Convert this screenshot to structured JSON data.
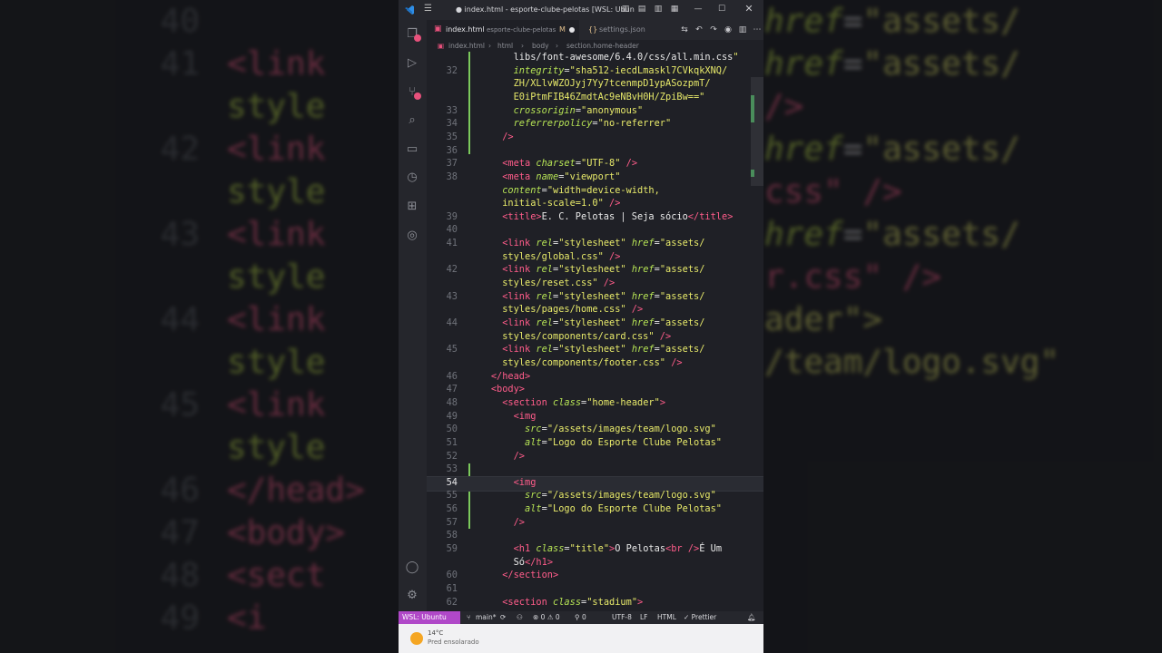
{
  "background": {
    "left_lines": [
      {
        "no": "40",
        "text": ""
      },
      {
        "no": "41",
        "text": "<link"
      },
      {
        "no": "",
        "text": "style"
      },
      {
        "no": "42",
        "text": "<link"
      },
      {
        "no": "",
        "text": "style"
      },
      {
        "no": "43",
        "text": "<link"
      },
      {
        "no": "",
        "text": "style"
      },
      {
        "no": "44",
        "text": "<link"
      },
      {
        "no": "",
        "text": "style"
      },
      {
        "no": "45",
        "text": "<link"
      },
      {
        "no": "",
        "text": "style"
      },
      {
        "no": "46",
        "text": "</head>"
      },
      {
        "no": "47",
        "text": "<body>"
      },
      {
        "no": "48",
        "text": "<sect"
      },
      {
        "no": "49",
        "text": "<i"
      }
    ],
    "right_lines": [
      "href=\"assets/",
      "",
      "href=\"assets/",
      "/>",
      "href=\"assets/",
      "css\" />",
      "href=\"assets/",
      "r.css\" />",
      "",
      "",
      "",
      "",
      "ader\">",
      "",
      "/team/logo.svg\""
    ]
  },
  "titlebar": {
    "title": "● index.html - esporte-clube-pelotas [WSL: Ubun"
  },
  "tabs": [
    {
      "label": "index.html",
      "detail": "esporte-clube-pelotas",
      "status": "M",
      "active": true
    },
    {
      "label": "settings.json",
      "active": false
    }
  ],
  "breadcrumb": [
    "index.html",
    "html",
    "body",
    "section.home-header"
  ],
  "code_lines": [
    {
      "no": "",
      "html": "        <span class='tx'>libs/font-awesome/6.4.0/css/all.min.css</span><span class='st'>\"</span>"
    },
    {
      "no": "32",
      "html": "        <span class='at'>integrity</span>=<span class='st'>\"sha512-iecdLmaskl7CVkqkXNQ/</span>"
    },
    {
      "no": "",
      "html": "        <span class='st'>ZH/XLlvWZOJyj7Yy7tcenmpD1ypASozpmT/</span>"
    },
    {
      "no": "",
      "html": "        <span class='st'>E0iPtmFIB46ZmdtAc9eNBvH0H/ZpiBw==\"</span>"
    },
    {
      "no": "33",
      "html": "        <span class='at'>crossorigin</span>=<span class='st'>\"anonymous\"</span>"
    },
    {
      "no": "34",
      "html": "        <span class='at'>referrerpolicy</span>=<span class='st'>\"no-referrer\"</span>"
    },
    {
      "no": "35",
      "html": "      <span class='tg'>/&gt;</span>"
    },
    {
      "no": "36",
      "html": ""
    },
    {
      "no": "37",
      "html": "      <span class='tg'>&lt;meta</span> <span class='at'>charset</span>=<span class='st'>\"UTF-8\"</span> <span class='tg'>/&gt;</span>"
    },
    {
      "no": "38",
      "html": "      <span class='tg'>&lt;meta</span> <span class='at'>name</span>=<span class='st'>\"viewport\"</span>"
    },
    {
      "no": "",
      "html": "      <span class='at'>content</span>=<span class='st'>\"width=device-width,</span>"
    },
    {
      "no": "",
      "html": "      <span class='st'>initial-scale=1.0\"</span> <span class='tg'>/&gt;</span>"
    },
    {
      "no": "39",
      "html": "      <span class='tg'>&lt;title&gt;</span><span class='tx'>E. C. Pelotas | Seja sócio</span><span class='tg'>&lt;/title&gt;</span>"
    },
    {
      "no": "40",
      "html": ""
    },
    {
      "no": "41",
      "html": "      <span class='tg'>&lt;link</span> <span class='at'>rel</span>=<span class='st'>\"stylesheet\"</span> <span class='at'>href</span>=<span class='st'>\"assets/</span>"
    },
    {
      "no": "",
      "html": "      <span class='st'>styles/global.css\"</span> <span class='tg'>/&gt;</span>"
    },
    {
      "no": "42",
      "html": "      <span class='tg'>&lt;link</span> <span class='at'>rel</span>=<span class='st'>\"stylesheet\"</span> <span class='at'>href</span>=<span class='st'>\"assets/</span>"
    },
    {
      "no": "",
      "html": "      <span class='st'>styles/reset.css\"</span> <span class='tg'>/&gt;</span>"
    },
    {
      "no": "43",
      "html": "      <span class='tg'>&lt;link</span> <span class='at'>rel</span>=<span class='st'>\"stylesheet\"</span> <span class='at'>href</span>=<span class='st'>\"assets/</span>"
    },
    {
      "no": "",
      "html": "      <span class='st'>styles/pages/home.css\"</span> <span class='tg'>/&gt;</span>"
    },
    {
      "no": "44",
      "html": "      <span class='tg'>&lt;link</span> <span class='at'>rel</span>=<span class='st'>\"stylesheet\"</span> <span class='at'>href</span>=<span class='st'>\"assets/</span>"
    },
    {
      "no": "",
      "html": "      <span class='st'>styles/components/card.css\"</span> <span class='tg'>/&gt;</span>"
    },
    {
      "no": "45",
      "html": "      <span class='tg'>&lt;link</span> <span class='at'>rel</span>=<span class='st'>\"stylesheet\"</span> <span class='at'>href</span>=<span class='st'>\"assets/</span>"
    },
    {
      "no": "",
      "html": "      <span class='st'>styles/components/footer.css\"</span> <span class='tg'>/&gt;</span>"
    },
    {
      "no": "46",
      "html": "    <span class='tg'>&lt;/head&gt;</span>"
    },
    {
      "no": "47",
      "html": "    <span class='tg'>&lt;body&gt;</span>"
    },
    {
      "no": "48",
      "html": "      <span class='tg'>&lt;section</span> <span class='at'>class</span>=<span class='st'>\"home-header\"</span><span class='tg'>&gt;</span>"
    },
    {
      "no": "49",
      "html": "        <span class='tg'>&lt;img</span>"
    },
    {
      "no": "50",
      "html": "          <span class='at'>src</span>=<span class='st'>\"/assets/images/team/logo.svg\"</span>"
    },
    {
      "no": "51",
      "html": "          <span class='at'>alt</span>=<span class='st'>\"Logo do Esporte Clube Pelotas\"</span>"
    },
    {
      "no": "52",
      "html": "        <span class='tg'>/&gt;</span>"
    },
    {
      "no": "53",
      "html": ""
    },
    {
      "no": "54",
      "html": "        <span class='tg'>&lt;img</span>"
    },
    {
      "no": "55",
      "html": "          <span class='at'>src</span>=<span class='st'>\"/assets/images/team/logo.svg\"</span>"
    },
    {
      "no": "56",
      "html": "          <span class='at'>alt</span>=<span class='st'>\"Logo do Esporte Clube Pelotas\"</span>"
    },
    {
      "no": "57",
      "html": "        <span class='tg'>/&gt;</span>"
    },
    {
      "no": "58",
      "html": ""
    },
    {
      "no": "59",
      "html": "        <span class='tg'>&lt;h1</span> <span class='at'>class</span>=<span class='st'>\"title\"</span><span class='tg'>&gt;</span><span class='tx'>O Pelotas</span><span class='tg'>&lt;br /&gt;</span><span class='tx'>É Um</span>"
    },
    {
      "no": "",
      "html": "        <span class='tx'>Só</span><span class='tg'>&lt;/h1&gt;</span>"
    },
    {
      "no": "60",
      "html": "      <span class='tg'>&lt;/section&gt;</span>"
    },
    {
      "no": "61",
      "html": ""
    },
    {
      "no": "62",
      "html": "      <span class='tg'>&lt;section</span> <span class='at'>class</span>=<span class='st'>\"stadium\"</span><span class='tg'>&gt;</span>"
    }
  ],
  "current_line": "54",
  "statusbar": {
    "remote": "WSL: Ubuntu",
    "branch": "main*",
    "problems": "⊗ 0 ⚠ 0",
    "ports": "0",
    "encoding": "UTF-8",
    "eol": "LF",
    "language": "HTML",
    "formatter": "✓ Prettier"
  },
  "taskbar": {
    "temperature": "14°C",
    "weather": "Pred ensolarado"
  },
  "colors": {
    "tag": "#ff5c8a",
    "attribute": "#b6e355",
    "string": "#e7e96a",
    "remote_bg": "#b048c8",
    "badge": "#e8517c"
  }
}
